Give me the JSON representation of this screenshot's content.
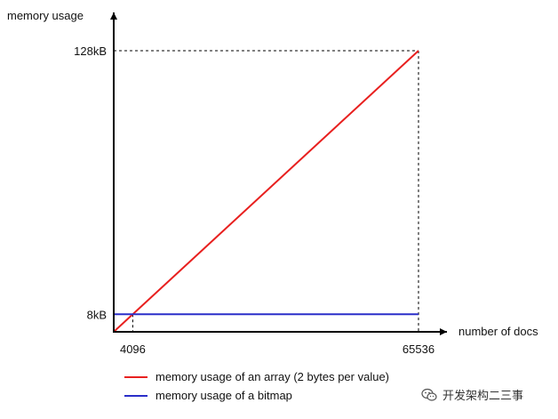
{
  "chart_data": {
    "type": "line",
    "xlabel": "number of docs",
    "ylabel": "memory usage",
    "x_ticks": [
      {
        "value": 4096,
        "label": "4096"
      },
      {
        "value": 65536,
        "label": "65536"
      }
    ],
    "y_ticks": [
      {
        "value": 8,
        "label": "8kB"
      },
      {
        "value": 128,
        "label": "128kB"
      }
    ],
    "xlim": [
      0,
      65536
    ],
    "ylim": [
      0,
      128
    ],
    "grid": false,
    "reference_lines": "dashed guides at x=4096, x=65536 and y=128",
    "series": [
      {
        "name": "memory usage of an array (2 bytes per value)",
        "color": "#e8201f",
        "x": [
          0,
          65536
        ],
        "y": [
          0,
          128
        ]
      },
      {
        "name": "memory usage of a bitmap",
        "color": "#2a2ec9",
        "x": [
          0,
          65536
        ],
        "y": [
          8,
          8
        ]
      }
    ]
  },
  "watermark": {
    "text": "开发架构二三事",
    "icon": "wechat-icon"
  }
}
